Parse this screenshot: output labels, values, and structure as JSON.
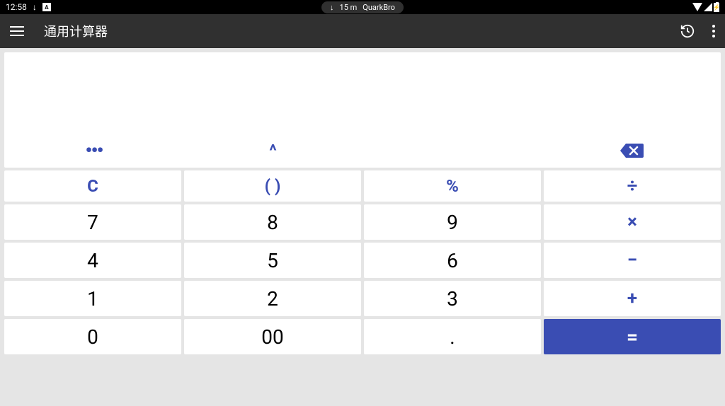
{
  "status": {
    "time": "12:58",
    "download": "↓",
    "indicator_a": "A",
    "pill_download": "↓",
    "pill_time": "15 m",
    "pill_app": "QuarkBro",
    "battery": "⚡"
  },
  "appbar": {
    "title": "通用计算器"
  },
  "display": {
    "value": ""
  },
  "funcs": {
    "more": "•••",
    "caret": "^",
    "backspace": "⌫"
  },
  "keys": {
    "clear": "C",
    "paren": "( )",
    "percent": "%",
    "divide": "÷",
    "n7": "7",
    "n8": "8",
    "n9": "9",
    "multiply": "×",
    "n4": "4",
    "n5": "5",
    "n6": "6",
    "minus": "−",
    "n1": "1",
    "n2": "2",
    "n3": "3",
    "plus": "+",
    "n0": "0",
    "n00": "00",
    "dot": ".",
    "equals": "="
  },
  "colors": {
    "accent": "#3a4db3",
    "barBg": "#303030",
    "pageBg": "#e5e5e5"
  }
}
